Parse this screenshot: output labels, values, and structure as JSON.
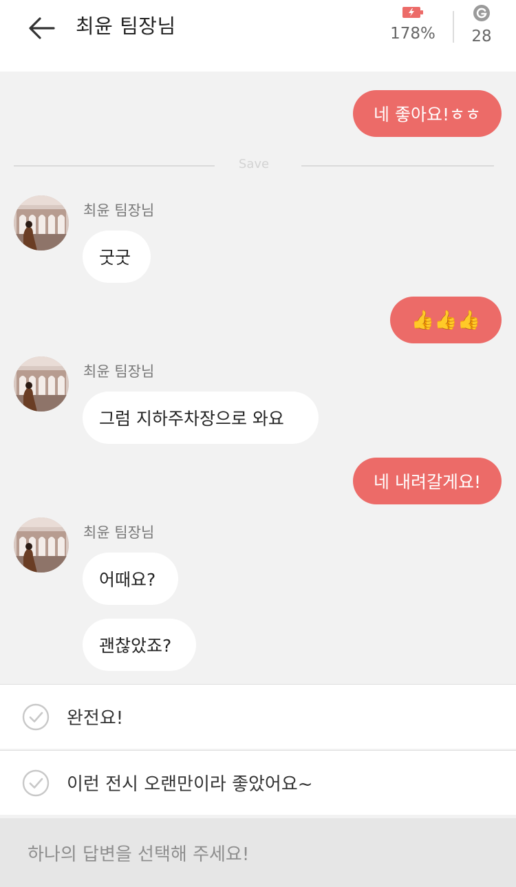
{
  "header": {
    "title": "최윤 팀장님",
    "battery_percent": "178%",
    "points": "28"
  },
  "chat": {
    "save_divider": "Save",
    "messages": [
      {
        "side": "out",
        "text": "네 좋아요!ㅎㅎ"
      },
      {
        "side": "in",
        "sender": "최윤 팀장님",
        "text": "굿굿"
      },
      {
        "side": "out",
        "text": "👍👍👍"
      },
      {
        "side": "in",
        "sender": "최윤 팀장님",
        "text": "그럼 지하주차장으로 와요"
      },
      {
        "side": "out",
        "text": "네 내려갈게요!"
      },
      {
        "side": "in",
        "sender": "최윤 팀장님",
        "text": "어때요?"
      },
      {
        "side": "in",
        "text": "괜찮았죠?"
      }
    ]
  },
  "options": [
    {
      "label": "완전요!"
    },
    {
      "label": "이런 전시 오랜만이라 좋았어요~"
    }
  ],
  "reply_bar": {
    "placeholder": "하나의 답변을 선택해 주세요!"
  },
  "colors": {
    "accent": "#ec6b68",
    "background": "#f2f2f2"
  }
}
